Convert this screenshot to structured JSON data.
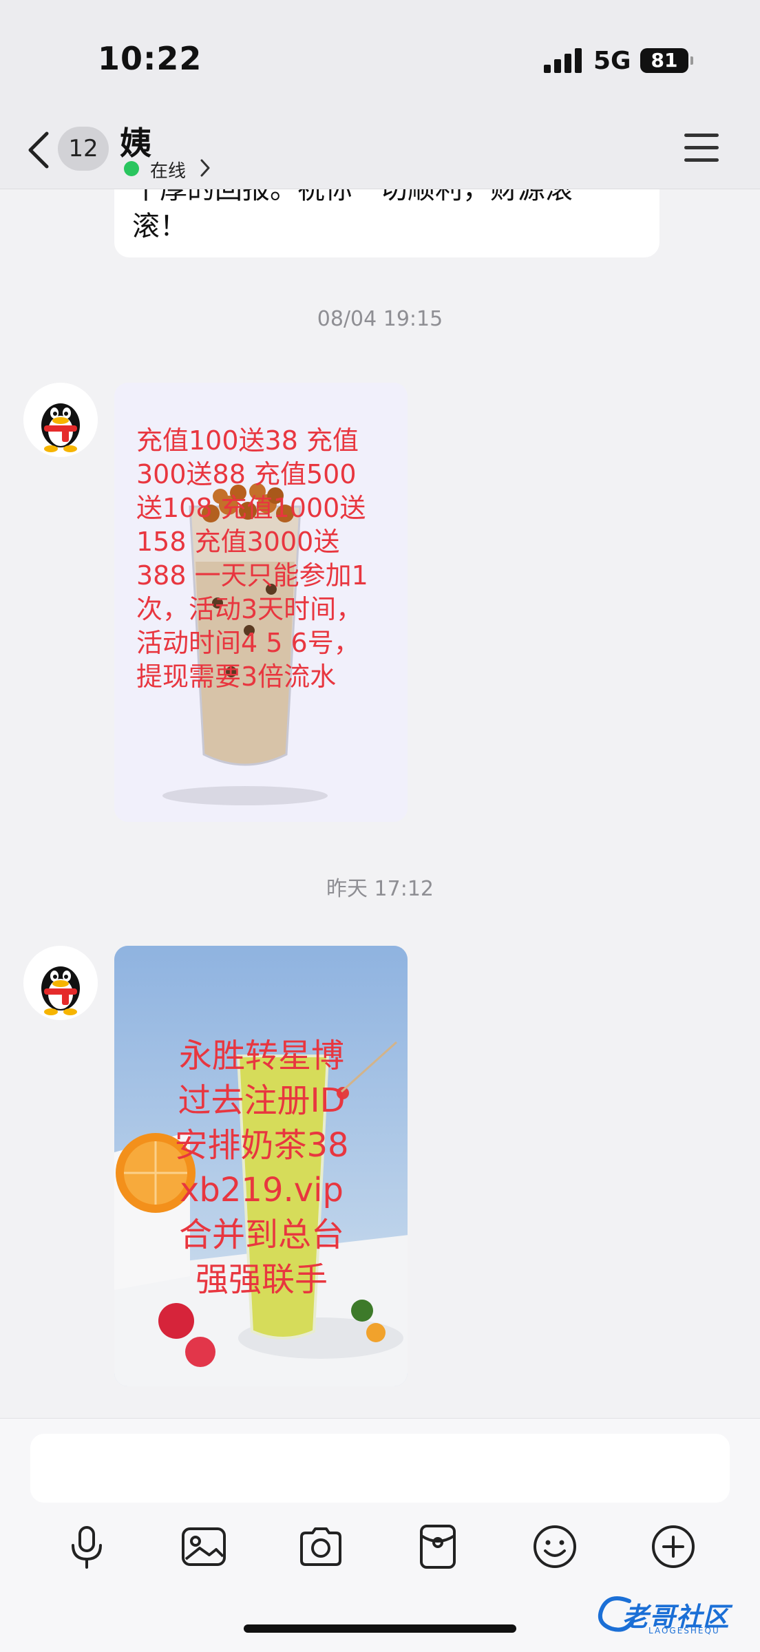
{
  "status_bar": {
    "time": "10:22",
    "network": "5G",
    "battery": "81"
  },
  "header": {
    "unread_count": "12",
    "contact_name": "姨",
    "status": "在线"
  },
  "messages": {
    "previous_text_lines": [
      "千厚的回报。祝你一切顺利，财源滚",
      "滚！"
    ],
    "timestamp_1": "08/04 19:15",
    "promo_1_lines": [
      "充值100送38   充值",
      "300送88   充值500",
      "送108   充值1000送",
      "158   充值3000送",
      "388   一天只能参加1",
      "次，活动3天时间，",
      "活动时间4  5  6号，",
      "提现需要3倍流水"
    ],
    "timestamp_2": "昨天 17:12",
    "promo_2_lines": [
      "永胜转星博",
      "过去注册ID",
      "安排奶茶38",
      "xb219.vip",
      "合并到总台",
      "强强联手"
    ]
  },
  "input": {
    "placeholder": ""
  },
  "toolbar_icons": [
    "microphone-icon",
    "image-icon",
    "camera-icon",
    "red-packet-icon",
    "emoji-icon",
    "plus-icon"
  ],
  "watermark": {
    "text": "老哥社区",
    "subtext": "LAOGESHEQU"
  },
  "colors": {
    "accent_red": "#e8363f",
    "online_green": "#29c55e",
    "background": "#f2f2f4"
  }
}
